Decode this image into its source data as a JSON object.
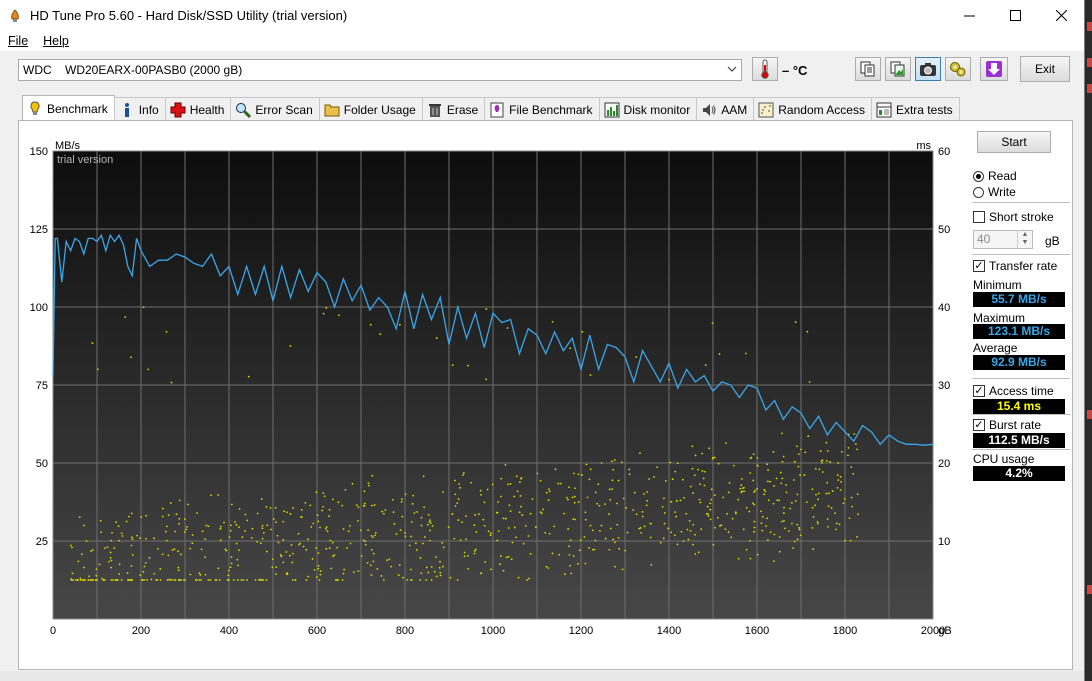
{
  "window": {
    "title": "HD Tune Pro 5.60 - Hard Disk/SSD Utility (trial version)",
    "controls": {
      "minimize": "—",
      "maximize": "☐",
      "close": "✕"
    }
  },
  "menu": {
    "file": "File",
    "help": "Help"
  },
  "toolbar": {
    "drive": "WDC    WD20EARX-00PASB0 (2000 gB)",
    "temperature": "– °C",
    "exit_label": "Exit"
  },
  "tabs": [
    {
      "label": "Benchmark",
      "icon": "bulb-icon"
    },
    {
      "label": "Info",
      "icon": "info-icon"
    },
    {
      "label": "Health",
      "icon": "health-cross-icon"
    },
    {
      "label": "Error Scan",
      "icon": "magnifier-icon"
    },
    {
      "label": "Folder Usage",
      "icon": "folder-icon"
    },
    {
      "label": "Erase",
      "icon": "trash-icon"
    },
    {
      "label": "File Benchmark",
      "icon": "file-benchmark-icon"
    },
    {
      "label": "Disk monitor",
      "icon": "disk-monitor-icon"
    },
    {
      "label": "AAM",
      "icon": "speaker-icon"
    },
    {
      "label": "Random Access",
      "icon": "random-access-icon"
    },
    {
      "label": "Extra tests",
      "icon": "extra-tests-icon"
    }
  ],
  "side": {
    "start_label": "Start",
    "read_label": "Read",
    "write_label": "Write",
    "short_stroke_label": "Short stroke",
    "short_stroke_value": "40",
    "short_stroke_unit": "gB",
    "transfer_rate_label": "Transfer rate",
    "minimum_label": "Minimum",
    "minimum_value": "55.7 MB/s",
    "maximum_label": "Maximum",
    "maximum_value": "123.1 MB/s",
    "average_label": "Average",
    "average_value": "92.9 MB/s",
    "access_time_label": "Access time",
    "access_time_value": "15.4 ms",
    "burst_rate_label": "Burst rate",
    "burst_rate_value": "112.5 MB/s",
    "cpu_usage_label": "CPU usage",
    "cpu_usage_value": "4.2%"
  },
  "colors": {
    "transfer_line": "#3aa6e8",
    "access_points": "#d8d800",
    "stat_blue": "#3aa6e8",
    "stat_yellow": "#ffff00",
    "stat_white": "#ffffff"
  },
  "chart_data": {
    "type": "line",
    "watermark": "trial version",
    "y_left_unit": "MB/s",
    "y_right_unit": "ms",
    "x_unit": "gB",
    "x_ticks": [
      0,
      200,
      400,
      600,
      800,
      1000,
      1200,
      1400,
      1600,
      1800,
      2000
    ],
    "y_left_ticks": [
      25,
      50,
      75,
      100,
      125,
      150
    ],
    "y_right_ticks": [
      10,
      20,
      30,
      40,
      50,
      60
    ],
    "xlim": [
      0,
      2000
    ],
    "ylim_left": [
      0,
      150
    ],
    "ylim_right": [
      0,
      60
    ],
    "grid": true,
    "series": [
      {
        "name": "Transfer rate",
        "axis": "left",
        "x": [
          0,
          5,
          10,
          20,
          30,
          40,
          50,
          60,
          70,
          80,
          90,
          100,
          110,
          120,
          130,
          140,
          150,
          160,
          170,
          180,
          190,
          200,
          220,
          240,
          260,
          280,
          300,
          320,
          340,
          360,
          380,
          400,
          420,
          440,
          460,
          480,
          500,
          520,
          540,
          560,
          580,
          600,
          620,
          640,
          660,
          680,
          700,
          720,
          740,
          760,
          780,
          800,
          820,
          840,
          860,
          880,
          900,
          920,
          940,
          960,
          980,
          1000,
          1020,
          1040,
          1060,
          1080,
          1100,
          1120,
          1140,
          1160,
          1180,
          1200,
          1220,
          1240,
          1260,
          1280,
          1300,
          1320,
          1340,
          1360,
          1380,
          1400,
          1420,
          1440,
          1460,
          1480,
          1500,
          1520,
          1540,
          1560,
          1580,
          1600,
          1620,
          1640,
          1660,
          1680,
          1700,
          1720,
          1740,
          1760,
          1780,
          1800,
          1820,
          1840,
          1860,
          1880,
          1900,
          1920,
          1940,
          1960,
          1980,
          2000
        ],
        "y": [
          78,
          122,
          122,
          108,
          121,
          118,
          122,
          121,
          117,
          122,
          122,
          121,
          123,
          118,
          123,
          121,
          123,
          120,
          113,
          110,
          122,
          118,
          113,
          115,
          115,
          117,
          116,
          114,
          113,
          117,
          110,
          113,
          104,
          113,
          104,
          113,
          102,
          113,
          103,
          112,
          105,
          111,
          108,
          100,
          109,
          102,
          107,
          99,
          103,
          100,
          93,
          105,
          93,
          104,
          96,
          103,
          88,
          100,
          90,
          98,
          87,
          98,
          95,
          96,
          85,
          93,
          91,
          85,
          92,
          86,
          90,
          80,
          91,
          80,
          88,
          87,
          84,
          76,
          86,
          81,
          76,
          82,
          74,
          80,
          76,
          78,
          73,
          76,
          75,
          71,
          75,
          74,
          67,
          70,
          64,
          68,
          66,
          61,
          65,
          59,
          63,
          60,
          57,
          62,
          60,
          56,
          59,
          57,
          56,
          56,
          55.7,
          56
        ]
      }
    ],
    "scatter_series": {
      "name": "Access time",
      "axis": "right",
      "seed": 20240,
      "count": 900
    }
  }
}
